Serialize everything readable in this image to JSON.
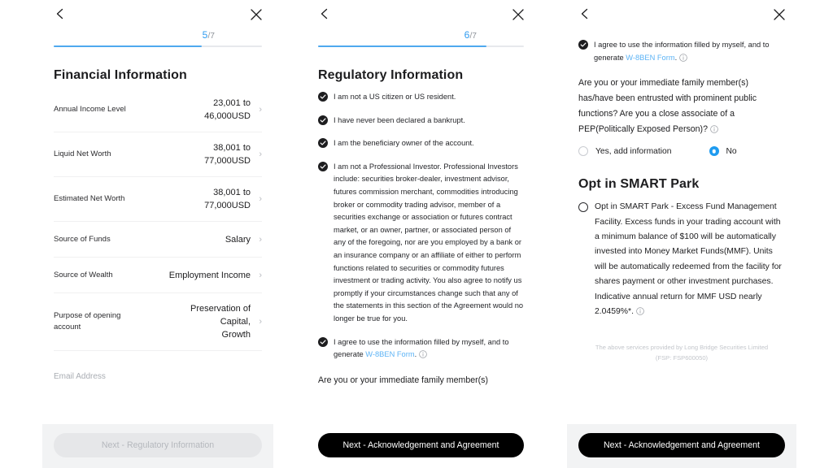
{
  "nav": {
    "back_icon": "chevron-left-icon",
    "close_icon": "close-icon"
  },
  "panel1": {
    "progress": {
      "current": "5",
      "denominator": "/7",
      "percent": 71
    },
    "title": "Financial Information",
    "rows": [
      {
        "label": "Annual Income Level",
        "value_lines": [
          "23,001 to",
          "46,000USD"
        ]
      },
      {
        "label": "Liquid Net Worth",
        "value_lines": [
          "38,001 to",
          "77,000USD"
        ]
      },
      {
        "label": "Estimated Net Worth",
        "value_lines": [
          "38,001 to",
          "77,000USD"
        ]
      },
      {
        "label": "Source of Funds",
        "value_lines": [
          "Salary"
        ]
      },
      {
        "label": "Source of Wealth",
        "value_lines": [
          "Employment Income"
        ]
      },
      {
        "label": "Purpose of opening account",
        "value_lines": [
          "Preservation of",
          "Capital,",
          "Growth"
        ]
      }
    ],
    "email_label": "Email Address",
    "cta_label": "Next - Regulatory Information",
    "cta_disabled": true
  },
  "panel2": {
    "progress": {
      "current": "6",
      "denominator": "/7",
      "percent": 82
    },
    "title": "Regulatory Information",
    "checks": [
      {
        "text": "I am not a US citizen or US resident.",
        "checked": true
      },
      {
        "text": "I have never been declared a bankrupt.",
        "checked": true
      },
      {
        "text": "I am the beneficiary owner of the account.",
        "checked": true
      },
      {
        "text": "I am not a Professional Investor. Professional Investors include: securities broker-dealer, investment advisor, futures commission merchant, commodities introducing broker or commodity trading advisor, member of a securities exchange or association or futures contract market, or an owner, partner, or associated person of any of the foregoing, nor are you employed by a bank or an insurance company or an affiliate of either to perform functions related to securities or commodity futures investment or trading activity. You also agree to notify us promptly if your circumstances change such that any of the statements in this section of the Agreement would no longer be true for you.",
        "checked": true
      }
    ],
    "w8ben": {
      "prefix": "I agree to use the information filled by myself, and to generate ",
      "link": "W-8BEN Form",
      "suffix": ".",
      "info_icon": "info-circle-icon",
      "checked": true
    },
    "question_partial": "Are you or your immediate family member(s)",
    "cta_label": "Next - Acknowledgement and Agreement"
  },
  "panel3": {
    "w8ben": {
      "prefix": "I agree to use the information filled by myself, and to generate ",
      "link": "W-8BEN Form",
      "suffix": ".",
      "info_icon": "info-circle-icon",
      "checked": true
    },
    "question": "Are you or your immediate family member(s) has/have been entrusted with prominent public functions? Are you a close associate of a PEP(Politically Exposed Person)?",
    "question_info_icon": "info-circle-icon",
    "radio_options": [
      {
        "label": "Yes, add information",
        "selected": false
      },
      {
        "label": "No",
        "selected": true
      }
    ],
    "optin_title": "Opt in SMART Park",
    "optin_text": "Opt in SMART Park - Excess Fund Management Facility. Excess funds in your trading account with a minimum balance of $100 will be automatically invested into Money Market Funds(MMF). Units will be automatically redeemed from the facility for shares payment or other investment purchases. Indicative annual return for MMF USD nearly 2.0459%*.",
    "optin_info_icon": "info-circle-icon",
    "optin_selected": false,
    "disclaimer_line1": "The above services provided by Long Bridge Securities Limited",
    "disclaimer_line2": "(FSP: FSP600050)",
    "cta_label": "Next - Acknowledgement and Agreement"
  },
  "colors": {
    "accent_blue": "#4fa9ee",
    "link_blue": "#5cb3f5",
    "radio_blue": "#1e9bf0",
    "cta_black": "#000000"
  }
}
